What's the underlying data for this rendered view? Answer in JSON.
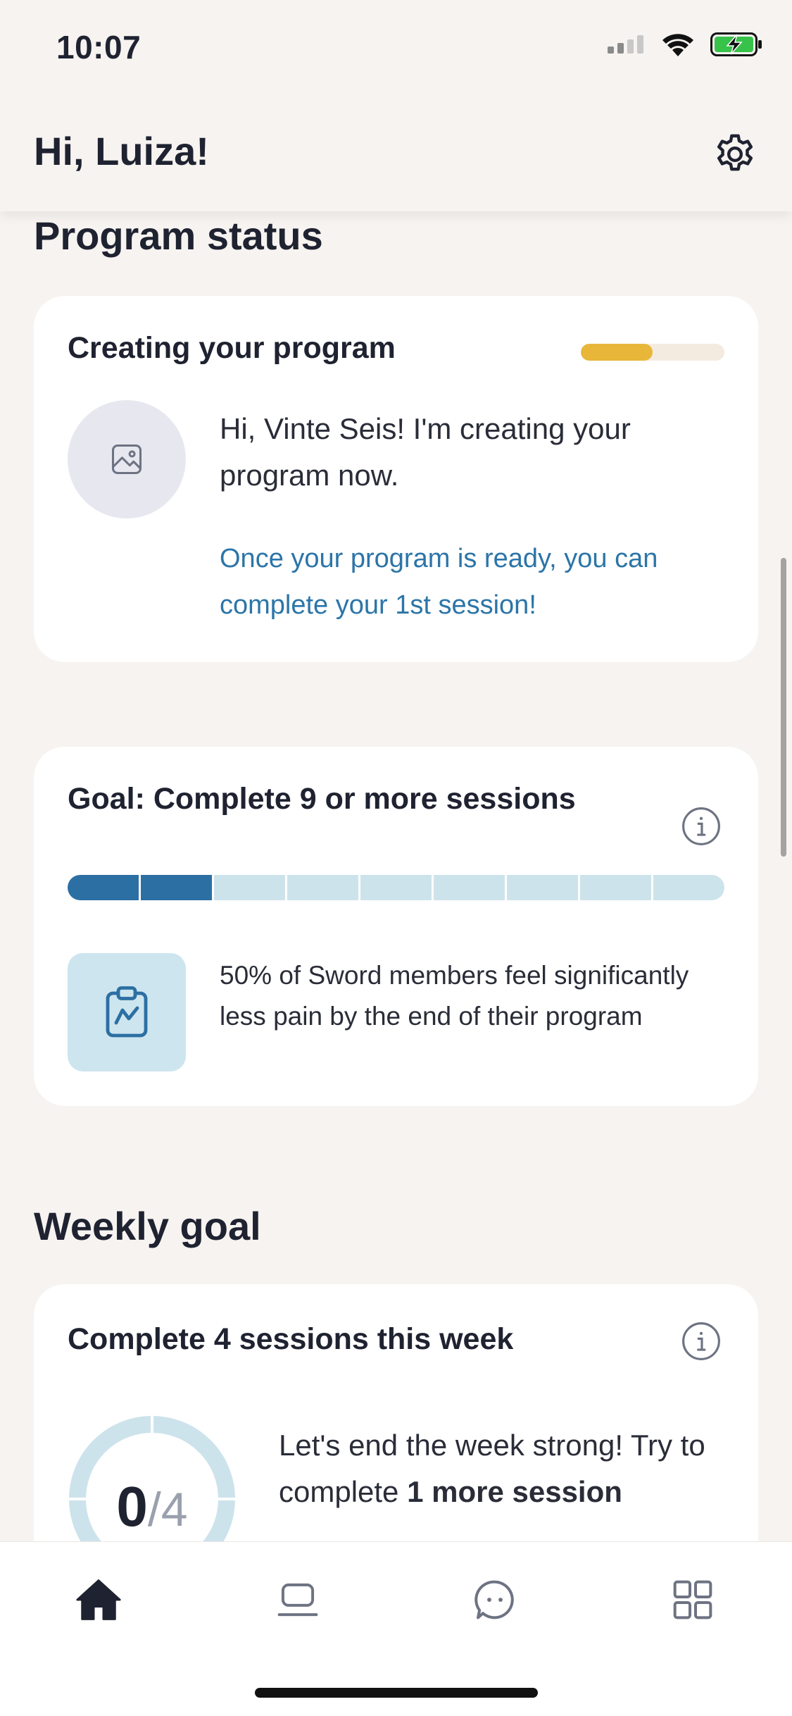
{
  "status_bar": {
    "time": "10:07"
  },
  "header": {
    "greeting": "Hi, Luiza!"
  },
  "program_status": {
    "section_title": "Program status",
    "card": {
      "title": "Creating your program",
      "progress": 0.5,
      "message": "Hi, Vinte Seis! I'm creating your program now.",
      "note": "Once your program is ready, you can complete your 1st session!"
    }
  },
  "goal_card": {
    "title": "Goal: Complete 9 or more sessions",
    "total_segments": 9,
    "completed_segments": 2,
    "fact": "50% of Sword members feel significantly less pain by the end of their program"
  },
  "weekly_goal": {
    "section_title": "Weekly goal",
    "card": {
      "title": "Complete 4 sessions this week",
      "completed": "0",
      "total": "/4",
      "message_start": "Let's end the week strong! Try to complete ",
      "message_bold": "1 more session"
    }
  },
  "tabs": [
    {
      "icon": "home-icon",
      "active": true
    },
    {
      "icon": "laptop-icon",
      "active": false
    },
    {
      "icon": "chat-icon",
      "active": false
    },
    {
      "icon": "grid-icon",
      "active": false
    }
  ],
  "colors": {
    "background": "#f6f3f0",
    "accent_blue": "#2c6fa3",
    "segment_empty": "#cde3ec",
    "progress_yellow": "#e8b73a",
    "link_blue": "#2c75a8"
  }
}
